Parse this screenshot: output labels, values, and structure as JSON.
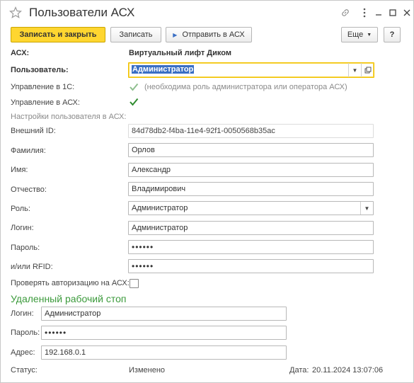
{
  "window": {
    "title": "Пользователи АСХ",
    "icons": [
      "star-icon",
      "link-icon",
      "more-icon",
      "minimize-icon",
      "maximize-icon",
      "close-icon"
    ]
  },
  "toolbar": {
    "save_close": "Записать и закрыть",
    "save": "Записать",
    "send": "Отправить в АСХ",
    "more": "Еще",
    "help": "?"
  },
  "form": {
    "acx_label": "АСХ:",
    "acx_value": "Виртуальный лифт Диком",
    "user_label": "Пользователь:",
    "user_value": "Администратор",
    "manage1c_label": "Управление в 1С:",
    "manage1c_checked": true,
    "manage1c_hint": "(необходима роль администратора или оператора АСХ)",
    "manageacx_label": "Управление в АСХ:",
    "manageacx_checked": true,
    "settings_header": "Настройки пользователя в АСХ:",
    "ext_id_label": "Внешний ID:",
    "ext_id_value": "84d78db2-f4ba-11e4-92f1-0050568b35ac",
    "lastname_label": "Фамилия:",
    "lastname_value": "Орлов",
    "firstname_label": "Имя:",
    "firstname_value": "Александр",
    "middlename_label": "Отчество:",
    "middlename_value": "Владимирович",
    "role_label": "Роль:",
    "role_value": "Администратор",
    "login_label": "Логин:",
    "login_value": "Администратор",
    "password_label": "Пароль:",
    "password_value": "••••••",
    "rfid_label": "и/или RFID:",
    "rfid_value": "••••••",
    "auth_check_label": "Проверять авторизацию на АСХ:",
    "auth_check_checked": false
  },
  "remote": {
    "header": "Удаленный рабочий стоп",
    "login_label": "Логин:",
    "login_value": "Администратор",
    "password_label": "Пароль:",
    "password_value": "••••••",
    "address_label": "Адрес:",
    "address_value": "192.168.0.1"
  },
  "status": {
    "label": "Статус:",
    "value": "Изменено",
    "date_label": "Дата:",
    "date_value": "20.11.2024 13:07:06"
  }
}
